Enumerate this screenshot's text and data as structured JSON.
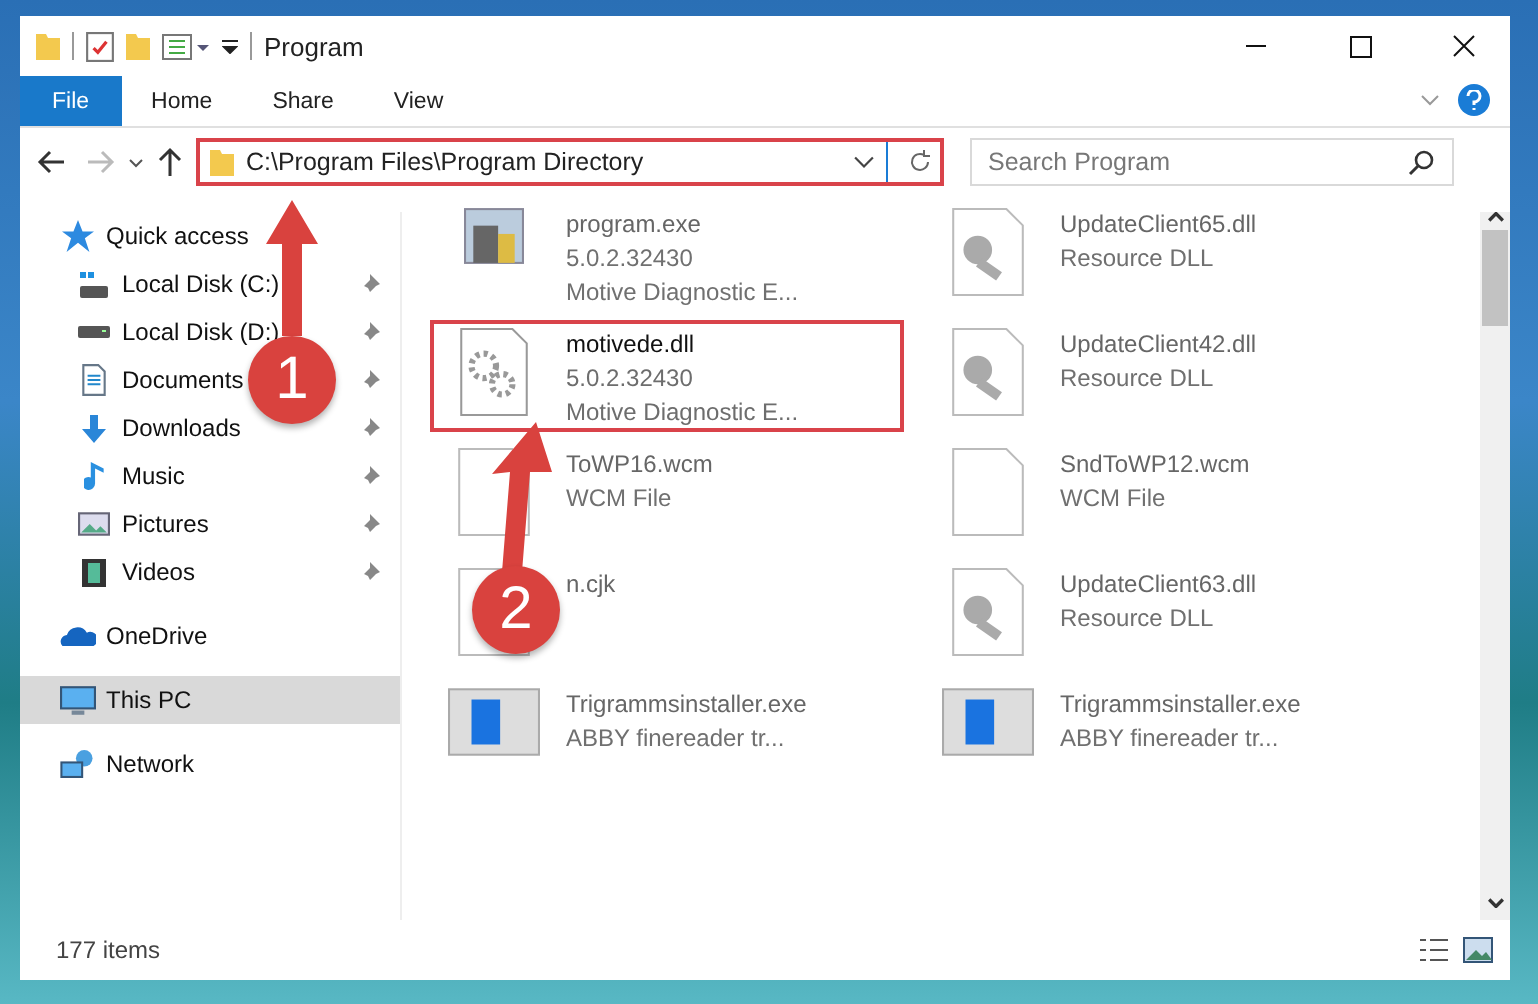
{
  "window": {
    "title": "Program"
  },
  "ribbon_tabs": [
    {
      "label": "File",
      "selected": true
    },
    {
      "label": "Home",
      "selected": false
    },
    {
      "label": "Share",
      "selected": false
    },
    {
      "label": "View",
      "selected": false
    }
  ],
  "address": {
    "path": "C:\\Program Files\\Program Directory",
    "highlighted": true
  },
  "search": {
    "placeholder": "Search Program"
  },
  "sidebar": {
    "items": [
      {
        "label": "Quick access",
        "kind": "star",
        "selected": false,
        "children": [
          {
            "label": "Local Disk (C:)",
            "kind": "system-disk",
            "pinned": true,
            "selected": false
          },
          {
            "label": "Local Disk (D:)",
            "kind": "disk",
            "pinned": true,
            "selected": false
          },
          {
            "label": "Documents",
            "kind": "document",
            "pinned": true,
            "selected": false
          },
          {
            "label": "Downloads",
            "kind": "download",
            "pinned": true,
            "selected": false
          },
          {
            "label": "Music",
            "kind": "music",
            "pinned": true,
            "selected": false
          },
          {
            "label": "Pictures",
            "kind": "pictures",
            "pinned": true,
            "selected": false
          },
          {
            "label": "Videos",
            "kind": "videos",
            "pinned": true,
            "selected": false
          }
        ]
      },
      {
        "label": "OneDrive",
        "kind": "cloud",
        "selected": false
      },
      {
        "label": "This PC",
        "kind": "computer",
        "selected": true
      },
      {
        "label": "Network",
        "kind": "network",
        "selected": false
      }
    ]
  },
  "files": [
    {
      "name": "program.exe",
      "lines": [
        "5.0.2.32430",
        "Motive Diagnostic E..."
      ],
      "kind": "program",
      "highlighted": false
    },
    {
      "name": "UpdateClient65.dll",
      "lines": [
        "Resource DLL"
      ],
      "kind": "library",
      "highlighted": false
    },
    {
      "name": "motivede.dll",
      "lines": [
        "5.0.2.32430",
        "Motive Diagnostic E..."
      ],
      "kind": "gear",
      "highlighted": true
    },
    {
      "name": "UpdateClient42.dll",
      "lines": [
        "Resource DLL"
      ],
      "kind": "library",
      "highlighted": false
    },
    {
      "name": "ToWP16.wcm",
      "lines": [
        "WCM File"
      ],
      "kind": "blank",
      "highlighted": false
    },
    {
      "name": "SndToWP12.wcm",
      "lines": [
        "WCM File"
      ],
      "kind": "blank",
      "highlighted": false
    },
    {
      "name": "n.cjk",
      "kind": "blank",
      "highlighted": false
    },
    {
      "name": "UpdateClient63.dll",
      "lines": [
        "Resource DLL"
      ],
      "kind": "library",
      "highlighted": false
    },
    {
      "name": "Trigrammsinstaller.exe",
      "lines": [
        "ABBY finereader tr..."
      ],
      "kind": "installer",
      "highlighted": false
    },
    {
      "name": "Trigrammsinstaller.exe",
      "lines": [
        "ABBY finereader tr..."
      ],
      "kind": "installer",
      "highlighted": false
    }
  ],
  "status_bar": {
    "count": "177 items"
  },
  "annotations": [
    {
      "kind": "arrow-up",
      "number": "1"
    },
    {
      "kind": "arrow-diagonal",
      "number": "2"
    }
  ]
}
